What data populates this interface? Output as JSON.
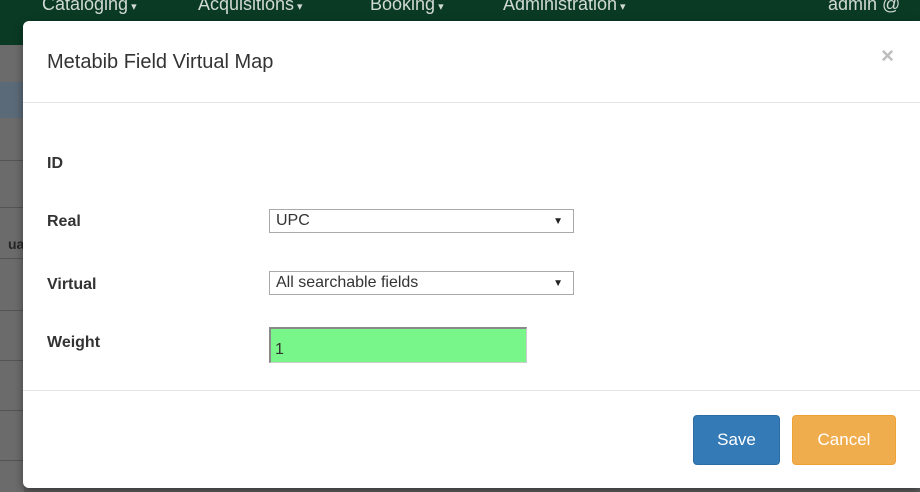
{
  "navbar": {
    "items": [
      {
        "label": "Cataloging"
      },
      {
        "label": "Acquisitions"
      },
      {
        "label": "Booking"
      },
      {
        "label": "Administration"
      },
      {
        "label": "admin @"
      }
    ],
    "caret": "▾"
  },
  "background": {
    "fragment_text": "ua"
  },
  "modal": {
    "title": "Metabib Field Virtual Map",
    "close_glyph": "×",
    "fields": {
      "id": {
        "label": "ID",
        "value": ""
      },
      "real": {
        "label": "Real",
        "selected": "UPC"
      },
      "virtual": {
        "label": "Virtual",
        "selected": "All searchable fields"
      },
      "weight": {
        "label": "Weight",
        "value": "1"
      }
    },
    "buttons": {
      "save": "Save",
      "cancel": "Cancel"
    },
    "dropdown_arrow": "▼"
  },
  "colors": {
    "navbar_bg": "#0a3a24",
    "save_button": "#337ab7",
    "cancel_button": "#f0ad4e",
    "weight_input_bg": "#78f68a"
  }
}
